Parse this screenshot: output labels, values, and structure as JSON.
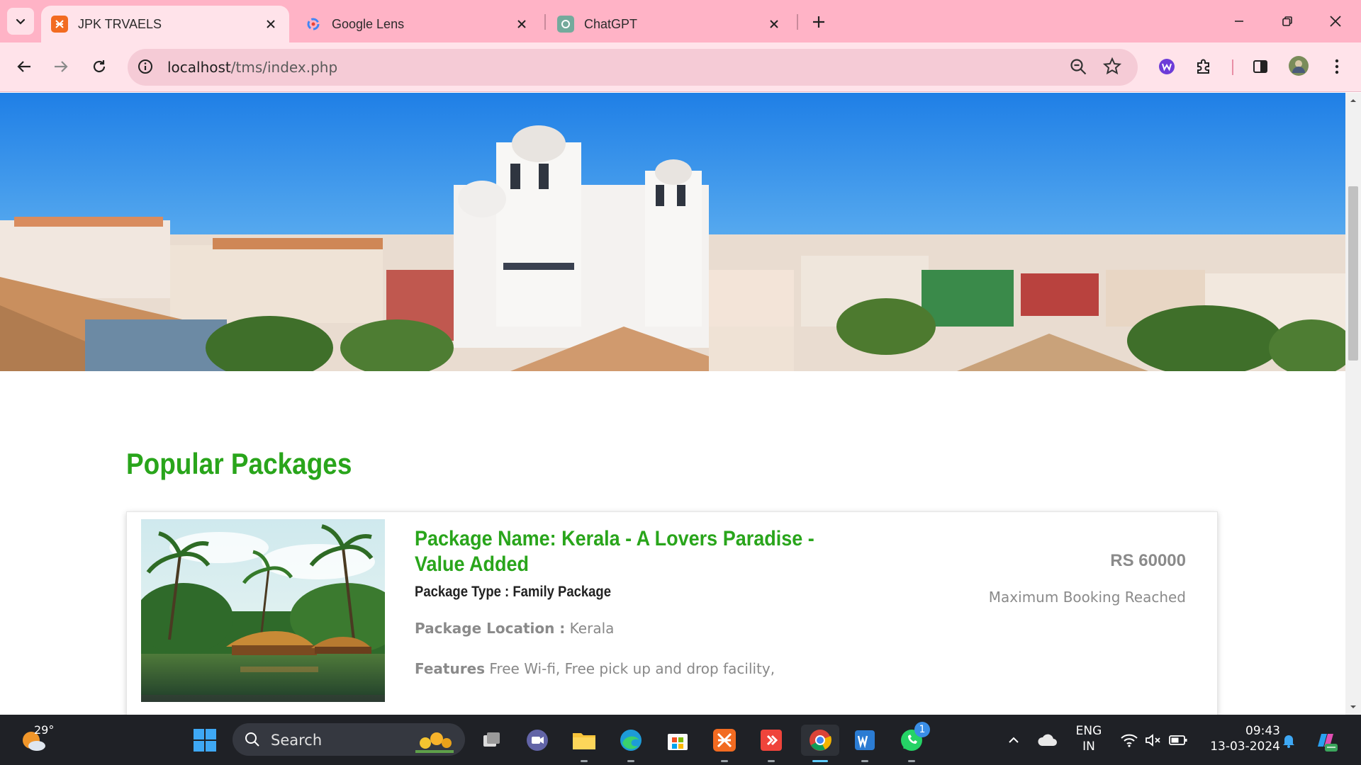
{
  "browser": {
    "tabs": [
      {
        "title": "JPK TRVAELS",
        "active": true,
        "favicon": "xampp-icon"
      },
      {
        "title": "Google Lens",
        "active": false,
        "favicon": "google-lens-icon"
      },
      {
        "title": "ChatGPT",
        "active": false,
        "favicon": "chatgpt-icon"
      }
    ],
    "url_host": "localhost",
    "url_path": "/tms/index.php"
  },
  "page": {
    "section_title": "Popular Packages",
    "packages": [
      {
        "name": "Package Name: Kerala - A Lovers Paradise - Value Added",
        "type": "Package Type : Family Package",
        "location_label": "Package Location :",
        "location": "Kerala",
        "features_label": "Features",
        "features": "Free Wi-fi, Free pick up and drop facility,",
        "price": "RS 60000",
        "status": "Maximum Booking Reached"
      }
    ],
    "accent_color": "#29a51b"
  },
  "taskbar": {
    "weather_temp": "29°",
    "search_label": "Search",
    "language_line1": "ENG",
    "language_line2": "IN",
    "time": "09:43",
    "date": "13-03-2024",
    "whatsapp_badge": "1"
  }
}
